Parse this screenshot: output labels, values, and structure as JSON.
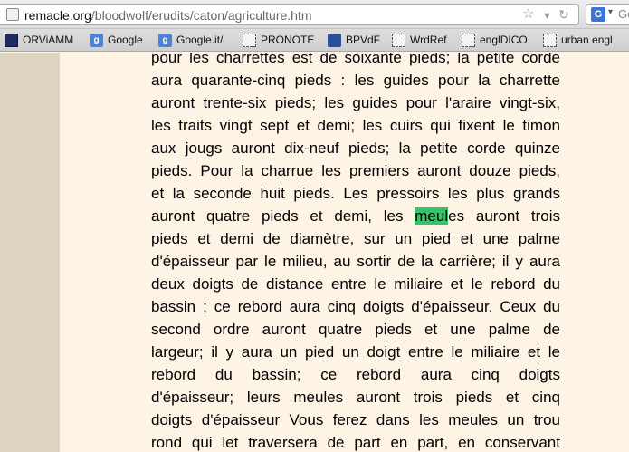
{
  "browser": {
    "url_host": "remacle.org",
    "url_path": "/bloodwolf/erudits/caton/agriculture.htm",
    "search_partial": "Go",
    "search_engine_icon": "G"
  },
  "bookmarks": [
    {
      "label": "ORViAMM",
      "icon": "orviamm-icon"
    },
    {
      "label": "Google",
      "icon": "google-icon"
    },
    {
      "label": "Google.it/",
      "icon": "google-icon"
    },
    {
      "label": "PRONOTE",
      "icon": "page-icon"
    },
    {
      "label": "BPVdF",
      "icon": "bpvdf-icon"
    },
    {
      "label": "WrdRef",
      "icon": "page-icon"
    },
    {
      "label": "englDICO",
      "icon": "page-icon"
    },
    {
      "label": "urban engl",
      "icon": "page-icon"
    }
  ],
  "article": {
    "lines": [
      "pour les charrettes est de soixante pieds; la petite corde",
      "aura quarante-cinq pieds : les guides pour la charrette",
      "auront trente-six pieds; les guides pour l'araire vingt-six,",
      "les traits vingt sept et demi; les cuirs qui fixent le timon",
      "aux jougs auront dix-neuf pieds; la petite corde quinze",
      "pieds. Pour la charrue les premiers auront douze pieds,",
      "et la seconde huit pieds. Les pressoirs les plus grands",
      "auront quatre pieds et demi, les meules auront trois",
      "pieds et demi de diamètre, sur un pied et une palme",
      "d'épaisseur par le milieu, au sortir de la carrière; il y aura",
      "deux doigts de distance entre le miliaire et le rebord du",
      "bassin ; ce rebord aura cinq doigts d'épaisseur. Ceux du",
      "second ordre auront quatre pieds et une palme de",
      "largeur; il y aura un pied un doigt entre le miliaire et le",
      "rebord du bassin; ce rebord aura cinq doigts",
      "d'épaisseur; leurs meules auront trois pieds et cinq",
      "doigts d'épaisseur Vous ferez dans les meules un trou",
      "rond qui let traversera de part en part, en conservant"
    ],
    "highlight": {
      "line_index": 7,
      "before": "auront quatre pieds et demi, les ",
      "match": "meul",
      "after": "es auront trois"
    },
    "highlight_color": "#39c26a"
  }
}
